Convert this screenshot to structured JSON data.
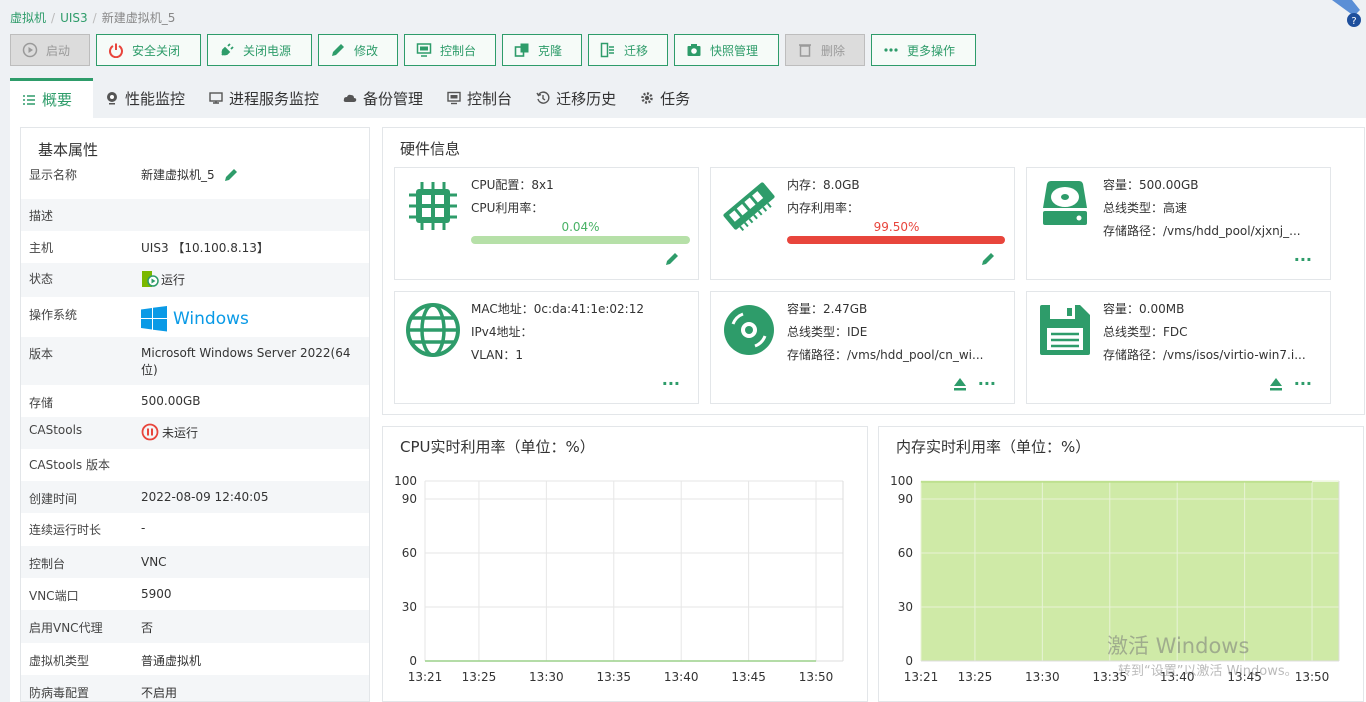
{
  "breadcrumb": [
    "虚拟机",
    "UIS3",
    "新建虚拟机_5"
  ],
  "toolbar": [
    {
      "label": "启动",
      "icon": "play-icon",
      "disabled": true
    },
    {
      "label": "安全关闭",
      "icon": "power-icon",
      "disabled": false
    },
    {
      "label": "关闭电源",
      "icon": "plug-icon",
      "disabled": false
    },
    {
      "label": "修改",
      "icon": "pencil-icon",
      "disabled": false
    },
    {
      "label": "控制台",
      "icon": "monitor-icon",
      "disabled": false
    },
    {
      "label": "克隆",
      "icon": "clone-icon",
      "disabled": false
    },
    {
      "label": "迁移",
      "icon": "migrate-icon",
      "disabled": false
    },
    {
      "label": "快照管理",
      "icon": "camera-icon",
      "disabled": false
    },
    {
      "label": "删除",
      "icon": "trash-icon",
      "disabled": true
    },
    {
      "label": "更多操作",
      "icon": "more-icon",
      "disabled": false
    }
  ],
  "tabs": [
    {
      "label": "概要",
      "active": true
    },
    {
      "label": "性能监控"
    },
    {
      "label": "进程服务监控"
    },
    {
      "label": "备份管理"
    },
    {
      "label": "控制台"
    },
    {
      "label": "迁移历史"
    },
    {
      "label": "任务"
    }
  ],
  "basic": {
    "title": "基本属性",
    "rows": [
      {
        "k": "显示名称",
        "v": "新建虚拟机_5"
      },
      {
        "k": "描述",
        "v": ""
      },
      {
        "k": "主机",
        "v": "UIS3 【10.100.8.13】"
      },
      {
        "k": "状态",
        "v": "运行"
      },
      {
        "k": "操作系统",
        "v": "Windows"
      },
      {
        "k": "版本",
        "v": "Microsoft Windows Server 2022(64位)"
      },
      {
        "k": "存储",
        "v": "500.00GB"
      },
      {
        "k": "CAStools",
        "v": "未运行"
      },
      {
        "k": "CAStools 版本",
        "v": ""
      },
      {
        "k": "创建时间",
        "v": "2022-08-09 12:40:05"
      },
      {
        "k": "连续运行时长",
        "v": "-"
      },
      {
        "k": "控制台",
        "v": "VNC"
      },
      {
        "k": "VNC端口",
        "v": "5900"
      },
      {
        "k": "启用VNC代理",
        "v": "否"
      },
      {
        "k": "虚拟机类型",
        "v": "普通虚拟机"
      },
      {
        "k": "防病毒配置",
        "v": "不启用"
      }
    ]
  },
  "hardware": {
    "title": "硬件信息",
    "cpu": {
      "l1": "CPU配置：8x1",
      "l2": "CPU利用率：",
      "usage": "0.04%",
      "usage_fraction": 0.0004
    },
    "mem": {
      "l1": "内存：8.0GB",
      "l2": "内存利用率：",
      "usage": "99.50%",
      "usage_fraction": 0.995
    },
    "disk": {
      "l1": "容量：500.00GB",
      "l2": "总线类型：高速",
      "l3": "存储路径：/vms/hdd_pool/xjxnj_..."
    },
    "net": {
      "l1": "MAC地址：0c:da:41:1e:02:12",
      "l2": "IPv4地址：",
      "l3": "VLAN：1"
    },
    "cdrom": {
      "l1": "容量：2.47GB",
      "l2": "总线类型：IDE",
      "l3": "存储路径：/vms/hdd_pool/cn_wi..."
    },
    "floppy": {
      "l1": "容量：0.00MB",
      "l2": "总线类型：FDC",
      "l3": "存储路径：/vms/isos/virtio-win7.i..."
    }
  },
  "colors": {
    "accent": "#2e9c6a",
    "cpu_bar": "#b6e0a8",
    "mem_bar": "#e8453c",
    "mem_fill": "#cfeaa7"
  },
  "chart_data": [
    {
      "type": "line",
      "title": "CPU实时利用率（单位：%）",
      "ylim": [
        0,
        100
      ],
      "yticks": [
        0,
        30,
        60,
        90,
        100
      ],
      "xticks": [
        "13:21",
        "13:25",
        "13:30",
        "13:35",
        "13:40",
        "13:45",
        "13:50"
      ],
      "series": [
        {
          "values": [
            0,
            0,
            0,
            0,
            0,
            0,
            0
          ]
        }
      ]
    },
    {
      "type": "area",
      "title": "内存实时利用率（单位：%）",
      "ylim": [
        0,
        100
      ],
      "yticks": [
        0,
        30,
        60,
        90,
        100
      ],
      "xticks": [
        "13:21",
        "13:25",
        "13:30",
        "13:35",
        "13:40",
        "13:45",
        "13:50"
      ],
      "series": [
        {
          "values": [
            99.5,
            99.5,
            99.5,
            99.5,
            99.5,
            99.5,
            99.5
          ]
        }
      ]
    }
  ],
  "watermark": {
    "line1": "激活 Windows",
    "line2": "转到“设置”以激活 Windows。"
  }
}
